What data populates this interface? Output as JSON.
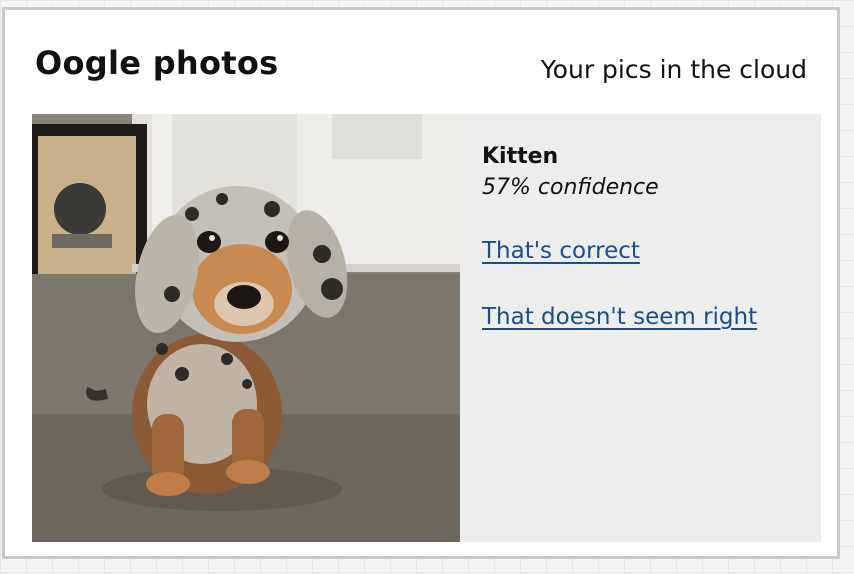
{
  "header": {
    "title": "Oogle photos",
    "tagline": "Your pics in the cloud"
  },
  "photo": {
    "subject": "dachshund puppy sitting on carpet"
  },
  "prediction": {
    "label": "Kitten",
    "confidence": "57% confidence"
  },
  "actions": {
    "correct": "That's correct",
    "incorrect": "That doesn't seem right"
  },
  "colors": {
    "link": "#1a4f88",
    "panel": "#ededed",
    "card_border": "#c9c9c9"
  }
}
